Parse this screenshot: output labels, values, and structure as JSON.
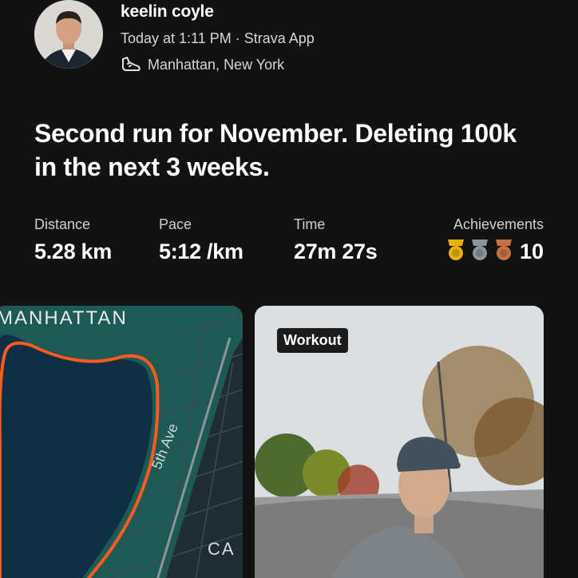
{
  "post": {
    "author": "keelin coyle",
    "meta": "Today at 1:11 PM · Strava App",
    "location": "Manhattan, New York",
    "title": "Second run for November. Deleting 100k in the next 3 weeks."
  },
  "stats": [
    {
      "label": "Distance",
      "value": "5.28 km"
    },
    {
      "label": "Pace",
      "value": "5:12 /km"
    },
    {
      "label": "Time",
      "value": "27m 27s"
    }
  ],
  "achievements": {
    "label": "Achievements",
    "count": "10",
    "medal_colors": [
      "#e9b400",
      "#8c9599",
      "#c8703f"
    ]
  },
  "map": {
    "area_label": "MANHATTAN",
    "street_label": "5th Ave",
    "partial_label": "CA",
    "route_color": "#ff5a1f"
  },
  "photo": {
    "tag": "Workout"
  },
  "icons": {
    "location": "shoe-icon"
  }
}
